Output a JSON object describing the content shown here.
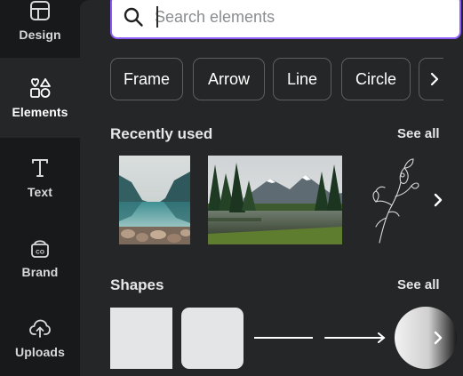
{
  "sidebar": {
    "items": [
      {
        "label": "Design",
        "icon": "design-icon",
        "active": false
      },
      {
        "label": "Elements",
        "icon": "elements-icon",
        "active": true
      },
      {
        "label": "Text",
        "icon": "text-icon",
        "active": false
      },
      {
        "label": "Brand",
        "icon": "brand-icon",
        "active": false
      },
      {
        "label": "Uploads",
        "icon": "uploads-icon",
        "active": false
      }
    ]
  },
  "search": {
    "placeholder": "Search elements",
    "value": ""
  },
  "chips": [
    "Frame",
    "Arrow",
    "Line",
    "Circle"
  ],
  "recently_used": {
    "title": "Recently used",
    "see_all": "See all",
    "items": [
      {
        "name": "lake-mountain-reflection-photo"
      },
      {
        "name": "forest-lake-mountains-photo"
      },
      {
        "name": "magnolia-line-drawing"
      }
    ]
  },
  "shapes": {
    "title": "Shapes",
    "see_all": "See all",
    "items": [
      {
        "name": "square-shape"
      },
      {
        "name": "rounded-square-shape"
      },
      {
        "name": "line-shape"
      },
      {
        "name": "arrow-line-shape"
      },
      {
        "name": "circle-shape"
      }
    ]
  },
  "colors": {
    "rail_bg": "#18191b",
    "panel_bg": "#252627",
    "search_border": "#8b5cf6",
    "chip_border": "#5d5f62",
    "shape_fill": "#e4e5e7"
  }
}
